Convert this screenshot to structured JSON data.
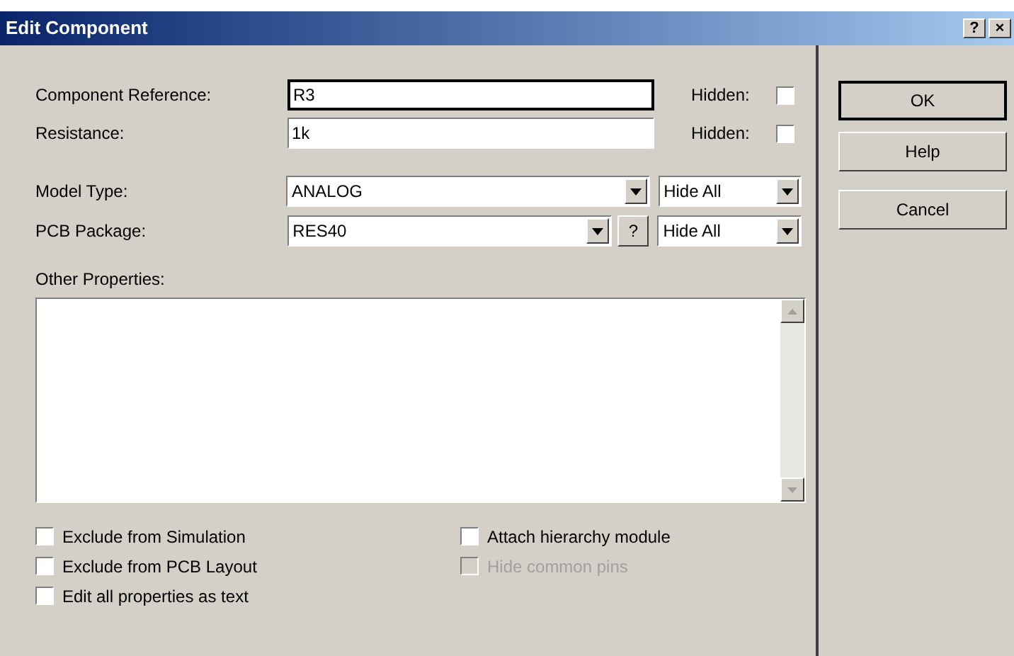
{
  "window": {
    "title": "Edit Component",
    "title_buttons": [
      "?",
      "×"
    ]
  },
  "fields": [
    {
      "label": "Component Reference:",
      "value": "R3",
      "focused": true,
      "hidden_label": "Hidden:",
      "hidden": false
    },
    {
      "label": "Resistance:",
      "value": "1k",
      "focused": false,
      "hidden_label": "Hidden:",
      "hidden": false
    }
  ],
  "selects": [
    {
      "label": "Model Type:",
      "value": "ANALOG",
      "help": false,
      "visibility": "Hide All"
    },
    {
      "label": "PCB Package:",
      "value": "RES40",
      "help": true,
      "help_label": "?",
      "visibility": "Hide All"
    }
  ],
  "other_properties": {
    "label": "Other Properties:"
  },
  "options_left": [
    {
      "label": "Exclude from Simulation",
      "checked": false,
      "disabled": false
    },
    {
      "label": "Exclude from PCB Layout",
      "checked": false,
      "disabled": false
    },
    {
      "label": "Edit all properties as text",
      "checked": false,
      "disabled": false
    }
  ],
  "options_right": [
    {
      "label": "Attach hierarchy module",
      "checked": false,
      "disabled": false
    },
    {
      "label": "Hide common pins",
      "checked": false,
      "disabled": true
    }
  ],
  "buttons": [
    {
      "label": "OK",
      "default": true
    },
    {
      "label": "Help",
      "default": false
    },
    {
      "label": "Cancel",
      "default": false
    }
  ]
}
